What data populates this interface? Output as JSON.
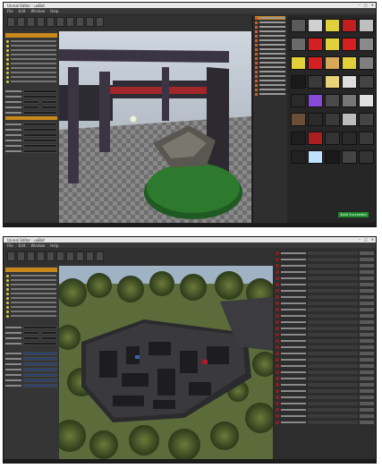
{
  "windows": [
    {
      "title": "Unreal Editor - ueBot",
      "menu": [
        "File",
        "Edit",
        "Window",
        "Help"
      ],
      "status_badge": "Build Succeeded"
    },
    {
      "title": "Unreal Editor - ueBot",
      "menu": [
        "File",
        "Edit",
        "Window",
        "Help"
      ]
    }
  ],
  "colors": {
    "accent": "#c8881a",
    "success": "#1d8a2c",
    "panel": "#353535"
  },
  "content_tiles": [
    "#5a5a5a",
    "#d0d0d0",
    "#e0d13a",
    "#c22020",
    "#bfbfbf",
    "#6a6a6a",
    "#d42020",
    "#e0d13a",
    "#d42020",
    "#8a8a8a",
    "#e0d13a",
    "#d42020",
    "#d7a85a",
    "#e0d13a",
    "#7f7f7f",
    "#1a1a1a",
    "#3a3a3a",
    "#e8d27a",
    "#ddd",
    "#444",
    "#2a2a2a",
    "#8a4ad9",
    "#4a4a4a",
    "#777",
    "#e0e0e0",
    "#6b4e38",
    "#2b2b2b",
    "#3a3a3a",
    "#bcbcbc",
    "#444",
    "#1e1e1e",
    "#aa2020",
    "#333",
    "#2a2a2a",
    "#3a3a3a",
    "#222",
    "#bfe1ff",
    "#1a1a1a",
    "#444",
    "#333"
  ]
}
